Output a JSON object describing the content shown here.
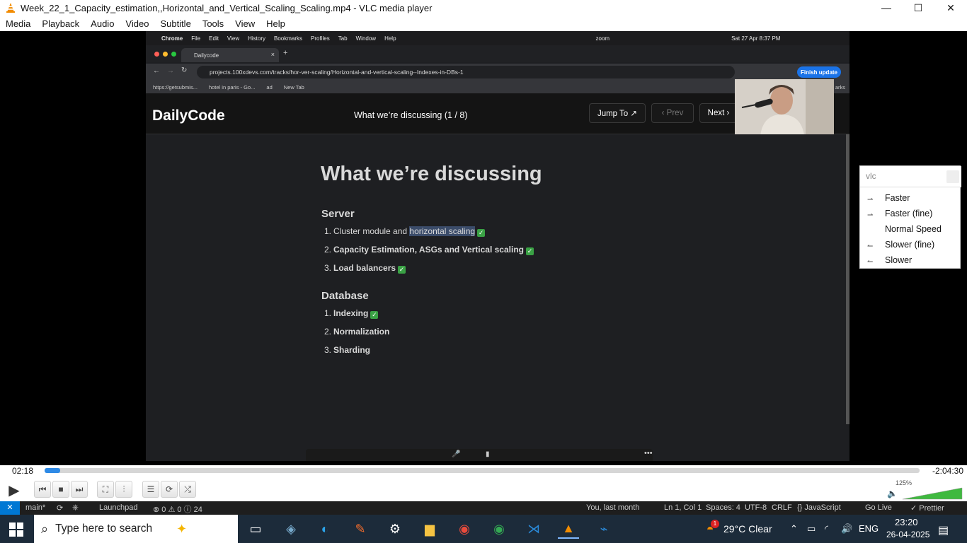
{
  "window": {
    "title": "Week_22_1_Capacity_estimation,,Horizontal_and_Vertical_Scaling_Scaling.mp4 - VLC media player",
    "controls": {
      "minimize": "—",
      "maximize": "☐",
      "close": "✕"
    }
  },
  "menu": [
    "Media",
    "Playback",
    "Audio",
    "Video",
    "Subtitle",
    "Tools",
    "View",
    "Help"
  ],
  "mac_bar": {
    "left": [
      "Chrome",
      "File",
      "Edit",
      "View",
      "History",
      "Bookmarks",
      "Profiles",
      "Tab",
      "Window",
      "Help"
    ],
    "zoom": "zoom",
    "datetime": "Sat 27 Apr  8:37 PM"
  },
  "browser": {
    "tab_title": "Dailycode",
    "url": "projects.100xdevs.com/tracks/hor-ver-scaling/Horizontal-and-vertical-scaling--Indexes-in-DBs-1",
    "finish_update": "Finish update",
    "bookmarks": [
      "https://getsubmis...",
      "hotel in paris - Go...",
      "ad",
      "New Tab"
    ],
    "bookmarks_right": "arks"
  },
  "page": {
    "logo": "DailyCode",
    "header_title": "What we’re discussing (1 / 8)",
    "jump_to": "Jump To ↗",
    "prev": "‹  Prev",
    "next": "Next  ›",
    "slide_title": "What we’re discussing",
    "server_heading": "Server",
    "server_items": [
      {
        "num": "1.",
        "pre": "Cluster module and ",
        "hl": "horizontal scaling"
      },
      {
        "num": "2.",
        "text": "Capacity Estimation, ASGs and Vertical scaling"
      },
      {
        "num": "3.",
        "text": "Load balancers"
      }
    ],
    "database_heading": "Database",
    "database_items": [
      {
        "num": "1.",
        "text": "Indexing"
      },
      {
        "num": "2.",
        "text": "Normalization"
      },
      {
        "num": "3.",
        "text": "Sharding"
      }
    ],
    "check": "✓"
  },
  "speed_menu": {
    "search_placeholder": "vlc",
    "options": [
      "Faster",
      "Faster (fine)",
      "Normal Speed",
      "Slower (fine)",
      "Slower"
    ]
  },
  "player": {
    "elapsed": "02:18",
    "remaining": "-2:04:30",
    "progress_fraction": 0.018,
    "volume_label": "125%",
    "volume_fraction": 1.0
  },
  "statusbar": {
    "branch": "main*",
    "launchpad": "Launchpad",
    "problems": "⊗ 0  ⚠ 0  ⓘ 24",
    "blame": "You, last month",
    "position": "Ln 1, Col 1",
    "spaces": "Spaces: 4",
    "encoding": "UTF-8",
    "eol": "CRLF",
    "language": "{} JavaScript",
    "golive": "Go Live",
    "prettier": "✓ Prettier"
  },
  "taskbar": {
    "search_placeholder": "Type here to search",
    "weather": "29°C  Clear",
    "weather_badge": "1",
    "lang": "ENG",
    "time": "23:20",
    "date": "26-04-2025"
  },
  "colors": {
    "accent_blue": "#2e8ae6",
    "check_green": "#3aa245",
    "vlc_orange": "#f28c00",
    "taskbar": "#1c2b3a",
    "vscode_blue": "#0078d4"
  }
}
